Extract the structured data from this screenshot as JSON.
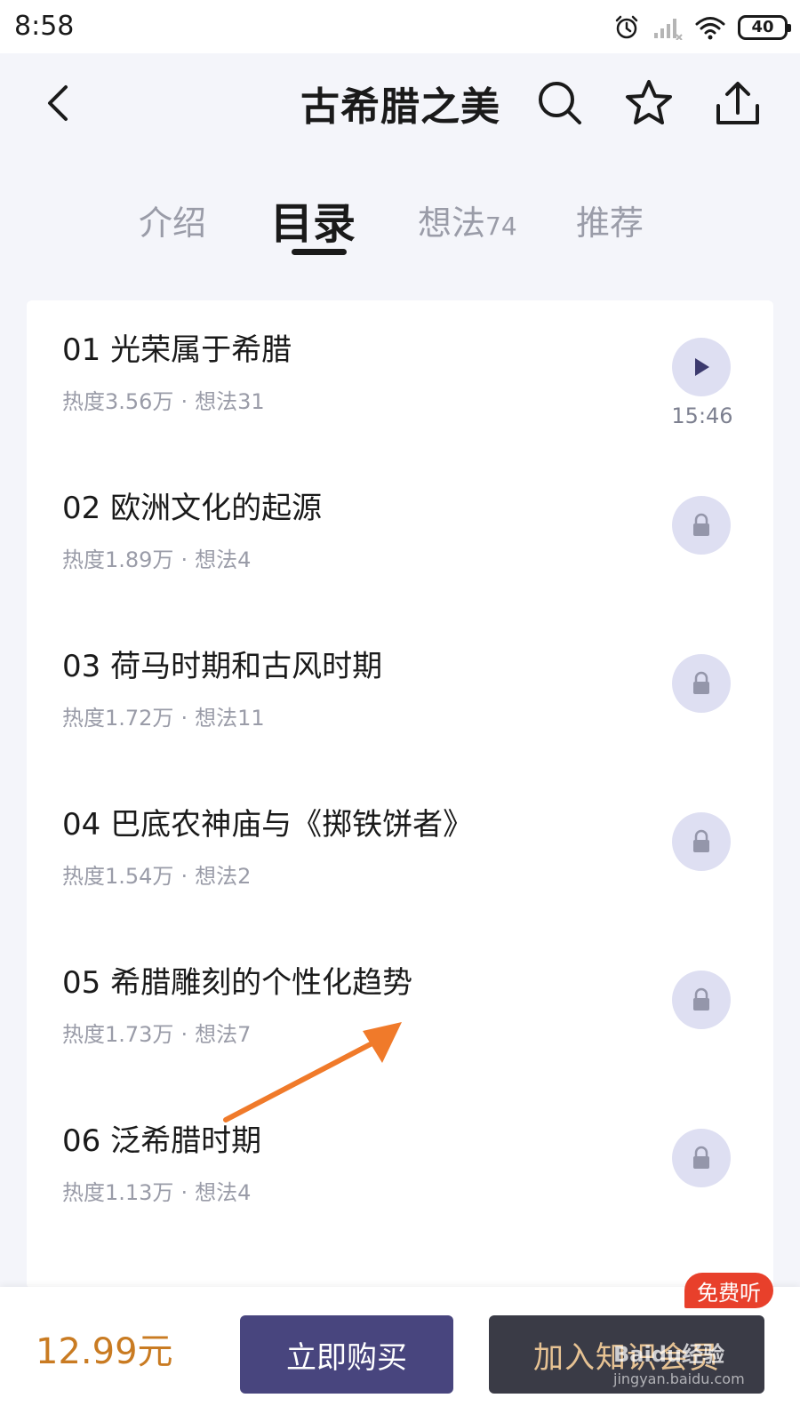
{
  "status_bar": {
    "time": "8:58",
    "battery": "40"
  },
  "header": {
    "title": "古希腊之美",
    "icons": [
      "back-arrow-icon",
      "search-icon",
      "star-icon",
      "share-icon"
    ]
  },
  "tabs": [
    {
      "label": "介绍",
      "count": ""
    },
    {
      "label": "目录",
      "count": ""
    },
    {
      "label": "想法",
      "count": "74"
    },
    {
      "label": "推荐",
      "count": ""
    }
  ],
  "active_tab": 1,
  "lessons": [
    {
      "title": "01 光荣属于希腊",
      "heat": "热度3.56万",
      "ideas": "想法31",
      "duration": "15:46",
      "state": "play"
    },
    {
      "title": "02 欧洲文化的起源",
      "heat": "热度1.89万",
      "ideas": "想法4",
      "state": "locked"
    },
    {
      "title": "03 荷马时期和古风时期",
      "heat": "热度1.72万",
      "ideas": "想法11",
      "state": "locked"
    },
    {
      "title": "04 巴底农神庙与《掷铁饼者》",
      "heat": "热度1.54万",
      "ideas": "想法2",
      "state": "locked"
    },
    {
      "title": "05 希腊雕刻的个性化趋势",
      "heat": "热度1.73万",
      "ideas": "想法7",
      "state": "locked"
    },
    {
      "title": "06 泛希腊时期",
      "heat": "热度1.13万",
      "ideas": "想法4",
      "state": "locked"
    }
  ],
  "meta_separator": "·",
  "bottom_bar": {
    "price": "12.99元",
    "buy_label": "立即购买",
    "member_label": "加入知识会员",
    "free_badge": "免费听"
  },
  "watermark": {
    "text": "Baidu经验",
    "sub": "jingyan.baidu.com"
  },
  "colors": {
    "accent": "#48457e",
    "price": "#c97b22",
    "badge": "#e8402b",
    "annotation_arrow": "#f07a2a"
  }
}
